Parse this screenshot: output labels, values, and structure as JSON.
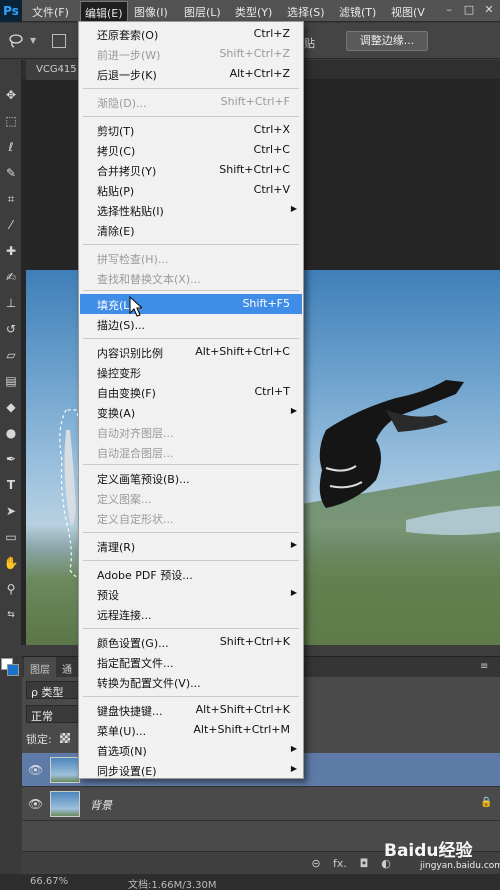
{
  "app": {
    "logo_text": "Ps"
  },
  "menubar": {
    "items": [
      "文件(F)",
      "编辑(E)",
      "图像(I)",
      "图层(L)",
      "类型(Y)",
      "选择(S)",
      "滤镜(T)",
      "视图(V"
    ],
    "active_index": 1,
    "window_buttons": [
      "–",
      "□",
      "✕"
    ]
  },
  "options_bar": {
    "partial_text": "贴",
    "refine_edge_button": "调整边缘..."
  },
  "document": {
    "tab_label": "VCG415"
  },
  "toolbar": {
    "tools": [
      "move-tool",
      "marquee-tool",
      "lasso-tool",
      "quick-select-tool",
      "crop-tool",
      "eyedropper-tool",
      "healing-tool",
      "brush-tool",
      "stamp-tool",
      "history-brush-tool",
      "eraser-tool",
      "gradient-tool",
      "blur-tool",
      "dodge-tool",
      "pen-tool",
      "type-tool",
      "path-select-tool",
      "shape-tool",
      "hand-tool",
      "zoom-tool"
    ],
    "foreground_color": "#ffffff",
    "background_color": "#1a72c9"
  },
  "edit_menu": {
    "items": [
      {
        "label": "还原套索(O)",
        "shortcut": "Ctrl+Z",
        "disabled": false
      },
      {
        "label": "前进一步(W)",
        "shortcut": "Shift+Ctrl+Z",
        "disabled": true
      },
      {
        "label": "后退一步(K)",
        "shortcut": "Alt+Ctrl+Z",
        "disabled": false
      },
      {
        "label": "渐隐(D)...",
        "shortcut": "Shift+Ctrl+F",
        "disabled": true
      },
      {
        "label": "剪切(T)",
        "shortcut": "Ctrl+X",
        "disabled": false
      },
      {
        "label": "拷贝(C)",
        "shortcut": "Ctrl+C",
        "disabled": false
      },
      {
        "label": "合并拷贝(Y)",
        "shortcut": "Shift+Ctrl+C",
        "disabled": false
      },
      {
        "label": "粘贴(P)",
        "shortcut": "Ctrl+V",
        "disabled": false
      },
      {
        "label": "选择性粘贴(I)",
        "shortcut": "",
        "disabled": false,
        "submenu": true
      },
      {
        "label": "清除(E)",
        "shortcut": "",
        "disabled": false
      },
      {
        "label": "拼写检查(H)...",
        "shortcut": "",
        "disabled": true
      },
      {
        "label": "查找和替换文本(X)...",
        "shortcut": "",
        "disabled": true
      },
      {
        "label": "填充(L)...",
        "shortcut": "Shift+F5",
        "disabled": false,
        "highlighted": true
      },
      {
        "label": "描边(S)...",
        "shortcut": "",
        "disabled": false
      },
      {
        "label": "内容识别比例",
        "shortcut": "Alt+Shift+Ctrl+C",
        "disabled": false
      },
      {
        "label": "操控变形",
        "shortcut": "",
        "disabled": false
      },
      {
        "label": "自由变换(F)",
        "shortcut": "Ctrl+T",
        "disabled": false
      },
      {
        "label": "变换(A)",
        "shortcut": "",
        "disabled": false,
        "submenu": true
      },
      {
        "label": "自动对齐图层...",
        "shortcut": "",
        "disabled": true
      },
      {
        "label": "自动混合图层...",
        "shortcut": "",
        "disabled": true
      },
      {
        "label": "定义画笔预设(B)...",
        "shortcut": "",
        "disabled": false
      },
      {
        "label": "定义图案...",
        "shortcut": "",
        "disabled": true
      },
      {
        "label": "定义自定形状...",
        "shortcut": "",
        "disabled": true
      },
      {
        "label": "清理(R)",
        "shortcut": "",
        "disabled": false,
        "submenu": true
      },
      {
        "label": "Adobe PDF 预设...",
        "shortcut": "",
        "disabled": false
      },
      {
        "label": "预设",
        "shortcut": "",
        "disabled": false,
        "submenu": true
      },
      {
        "label": "远程连接...",
        "shortcut": "",
        "disabled": false
      },
      {
        "label": "颜色设置(G)...",
        "shortcut": "Shift+Ctrl+K",
        "disabled": false
      },
      {
        "label": "指定配置文件...",
        "shortcut": "",
        "disabled": false
      },
      {
        "label": "转换为配置文件(V)...",
        "shortcut": "",
        "disabled": false
      },
      {
        "label": "键盘快捷键...",
        "shortcut": "Alt+Shift+Ctrl+K",
        "disabled": false
      },
      {
        "label": "菜单(U)...",
        "shortcut": "Alt+Shift+Ctrl+M",
        "disabled": false
      },
      {
        "label": "首选项(N)",
        "shortcut": "",
        "disabled": false,
        "submenu": true
      },
      {
        "label": "同步设置(E)",
        "shortcut": "",
        "disabled": false,
        "submenu": true
      }
    ]
  },
  "layers_panel": {
    "tabs": [
      "图层",
      "通"
    ],
    "filter_label": "ρ 类型",
    "blend_mode": "正常",
    "lock_label": "锁定:",
    "layers": [
      {
        "name": "",
        "selected": true
      },
      {
        "name": "背景",
        "selected": false,
        "locked": true
      }
    ],
    "footer_icons": [
      "link-icon",
      "fx-icon",
      "mask-icon",
      "adjustment-icon"
    ],
    "fx_label": "fx."
  },
  "status_bar": {
    "zoom": "66.67%",
    "doc_info": "文档:1.66M/3.30M"
  },
  "watermark": {
    "text": "Baidu经验",
    "sub": "jingyan.baidu.com"
  }
}
